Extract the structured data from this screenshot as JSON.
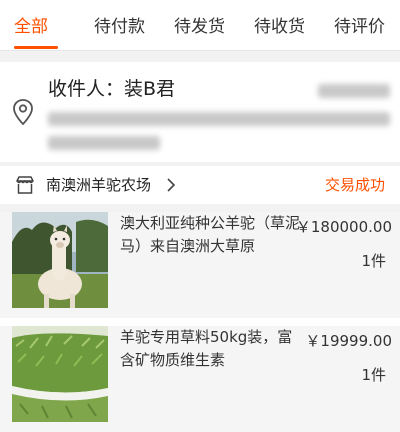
{
  "tabs": [
    {
      "label": "全部",
      "active": true
    },
    {
      "label": "待付款"
    },
    {
      "label": "待发货"
    },
    {
      "label": "待收货"
    },
    {
      "label": "待评价"
    }
  ],
  "address": {
    "recipient": "收件人：装B君",
    "icon": "location-pin-icon"
  },
  "shop": {
    "name": "南澳洲羊驼农场",
    "status": "交易成功",
    "icon": "store-icon"
  },
  "products": [
    {
      "title": "澳大利亚纯种公羊驼（草泥马）来自澳洲大草原",
      "price": "￥180000.00",
      "quantity": "1件",
      "image": "alpaca-photo"
    },
    {
      "title": "羊驼专用草料50kg装，富含矿物质维生素",
      "price": "￥19999.00",
      "quantity": "1件",
      "image": "hay-bale-photo"
    }
  ],
  "colors": {
    "accent": "#ff5000"
  }
}
